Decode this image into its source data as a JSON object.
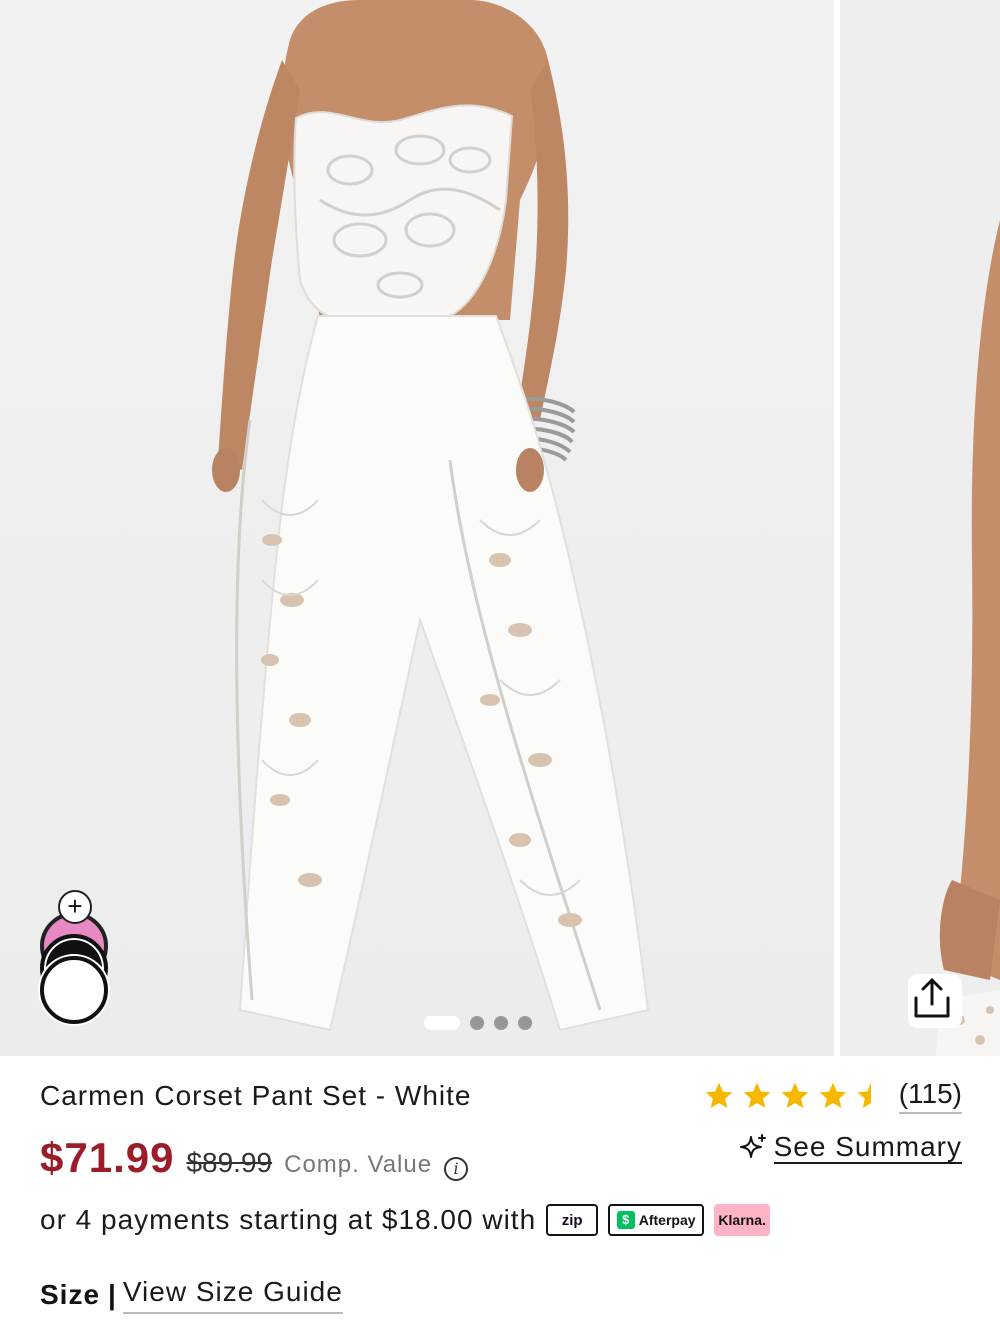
{
  "product": {
    "title": "Carmen Corset Pant Set - White",
    "rating": 4.5,
    "review_count": "(115)",
    "summary_link": "See Summary",
    "price_sale": "$71.99",
    "price_original": "$89.99",
    "comp_value_label": "Comp. Value",
    "info_icon_glyph": "i"
  },
  "gallery": {
    "image_count": 4,
    "active_index": 0,
    "swatches": [
      {
        "name": "pink",
        "color": "#e889c4"
      },
      {
        "name": "black",
        "color": "#111111"
      },
      {
        "name": "white",
        "color": "#ffffff"
      }
    ],
    "add_swatch_glyph": "+",
    "share_icon": "share-icon"
  },
  "payments": {
    "text": "or 4 payments starting at $18.00 with",
    "zip_label": "zip",
    "afterpay_label": "Afterpay",
    "afterpay_icon_glyph": "$",
    "klarna_label": "Klarna."
  },
  "size": {
    "label": "Size",
    "separator": "|",
    "guide_link": "View Size Guide"
  },
  "colors": {
    "price_sale": "#9b1d2a",
    "star": "#f5b800",
    "afterpay": "#00c060",
    "klarna": "#ffb3c7"
  }
}
